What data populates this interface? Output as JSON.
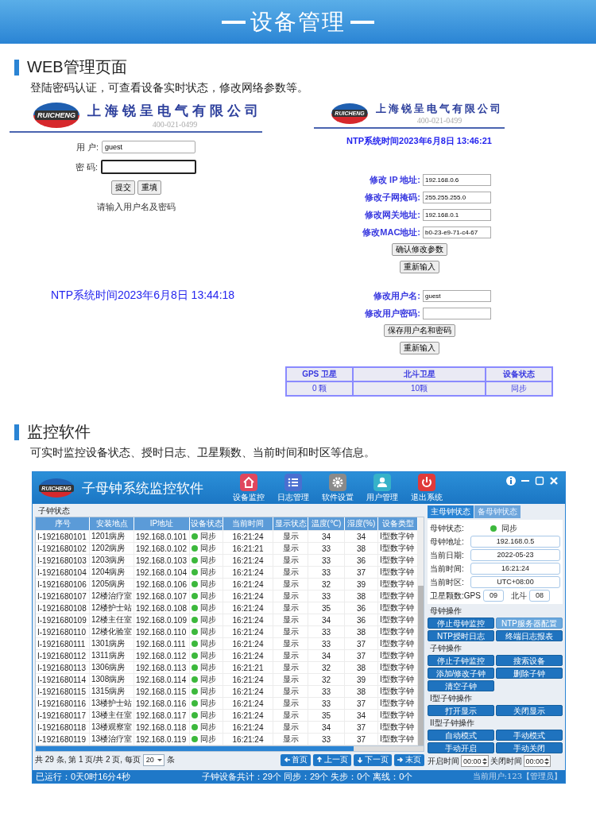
{
  "banner": {
    "title": "设备管理"
  },
  "sections": [
    {
      "heading": "WEB管理页面",
      "description": "登陆密码认证，可查看设备实时状态，修改网络参数等。"
    },
    {
      "heading": "监控软件",
      "description": "可实时监控设备状态、授时日志、卫星颗数、当前时间和时区等信息。"
    }
  ],
  "web_login": {
    "logo": "RUICHENG",
    "company": "上海锐呈电气有限公司",
    "phone": "400-021-0499",
    "fields": [
      {
        "label": "用 户:",
        "value": "guest",
        "focused": false
      },
      {
        "label": "密 码:",
        "focused": true
      }
    ],
    "buttons": [
      "提交",
      "重填"
    ],
    "prompt": "请输入用户名及密码",
    "ntp_time": "NTP系统时间2023年6月8日 13:44:18"
  },
  "web_config": {
    "logo": "RUICHENG",
    "company": "上海锐呈电气有限公司",
    "phone": "400-021-0499",
    "ntp_time": "NTP系统时间2023年6月8日 13:46:21",
    "network_fields": [
      {
        "label": "修改 IP 地址:",
        "value": "192.168.0.6"
      },
      {
        "label": "修改子网掩码:",
        "value": "255.255.255.0"
      },
      {
        "label": "修改网关地址:",
        "value": "192.168.0.1"
      },
      {
        "label": "修改MAC地址:",
        "value": "b0-23-e9-71-c4-67"
      }
    ],
    "network_buttons": [
      "确认修改参数",
      "重新输入"
    ],
    "user_fields": [
      {
        "label": "修改用户名:",
        "value": "guest"
      },
      {
        "label": "修改用户密码:"
      }
    ],
    "user_buttons": [
      "保存用户名和密码",
      "重新输入"
    ],
    "status_table": {
      "columns": [
        "GPS 卫星",
        "北斗卫星",
        "设备状态"
      ],
      "rows": [
        [
          "0 颗",
          "10颗",
          "同步"
        ]
      ]
    }
  },
  "software": {
    "logo": "RUICHENG",
    "title": "子母钟系统监控软件",
    "toolbar": [
      {
        "label": "设备监控",
        "kind": "home",
        "color": "#e0475e"
      },
      {
        "label": "日志管理",
        "kind": "list",
        "color": "#4a6fd0"
      },
      {
        "label": "软件设置",
        "kind": "gear",
        "color": "#8a8a8a"
      },
      {
        "label": "用户管理",
        "kind": "user",
        "color": "#36b2c9"
      },
      {
        "label": "退出系统",
        "kind": "power",
        "color": "#e03a3a"
      }
    ],
    "group_title": "子钟状态",
    "table": {
      "columns": [
        "序号",
        "安装地点",
        "IP地址",
        "设备状态",
        "当前时间",
        "显示状态",
        "温度(℃)",
        "湿度(%)",
        "设备类型"
      ],
      "rows": [
        [
          "I-1921680101",
          "1201病房",
          "192.168.0.101",
          "同步",
          "16:21:24",
          "显示",
          "34",
          "34",
          "I型数字钟"
        ],
        [
          "I-1921680102",
          "1202病房",
          "192.168.0.102",
          "同步",
          "16:21:21",
          "显示",
          "33",
          "38",
          "I型数字钟"
        ],
        [
          "I-1921680103",
          "1203病房",
          "192.168.0.103",
          "同步",
          "16:21:24",
          "显示",
          "33",
          "36",
          "I型数字钟"
        ],
        [
          "I-1921680104",
          "1204病房",
          "192.168.0.104",
          "同步",
          "16:21:24",
          "显示",
          "33",
          "37",
          "I型数字钟"
        ],
        [
          "I-1921680106",
          "1205病房",
          "192.168.0.106",
          "同步",
          "16:21:24",
          "显示",
          "32",
          "39",
          "I型数字钟"
        ],
        [
          "I-1921680107",
          "12楼治疗室",
          "192.168.0.107",
          "同步",
          "16:21:24",
          "显示",
          "33",
          "38",
          "I型数字钟"
        ],
        [
          "I-1921680108",
          "12楼护士站",
          "192.168.0.108",
          "同步",
          "16:21:24",
          "显示",
          "35",
          "36",
          "I型数字钟"
        ],
        [
          "I-1921680109",
          "12楼主任室",
          "192.168.0.109",
          "同步",
          "16:21:24",
          "显示",
          "34",
          "36",
          "I型数字钟"
        ],
        [
          "I-1921680110",
          "12楼化验室",
          "192.168.0.110",
          "同步",
          "16:21:24",
          "显示",
          "33",
          "38",
          "I型数字钟"
        ],
        [
          "I-1921680111",
          "1301病房",
          "192.168.0.111",
          "同步",
          "16:21:24",
          "显示",
          "33",
          "37",
          "I型数字钟"
        ],
        [
          "I-1921680112",
          "1311病房",
          "192.168.0.112",
          "同步",
          "16:21:24",
          "显示",
          "34",
          "37",
          "I型数字钟"
        ],
        [
          "I-1921680113",
          "1306病房",
          "192.168.0.113",
          "同步",
          "16:21:21",
          "显示",
          "32",
          "38",
          "I型数字钟"
        ],
        [
          "I-1921680114",
          "1308病房",
          "192.168.0.114",
          "同步",
          "16:21:24",
          "显示",
          "32",
          "39",
          "I型数字钟"
        ],
        [
          "I-1921680115",
          "1315病房",
          "192.168.0.115",
          "同步",
          "16:21:24",
          "显示",
          "33",
          "38",
          "I型数字钟"
        ],
        [
          "I-1921680116",
          "13楼护士站",
          "192.168.0.116",
          "同步",
          "16:21:24",
          "显示",
          "33",
          "37",
          "I型数字钟"
        ],
        [
          "I-1921680117",
          "13楼主任室",
          "192.168.0.117",
          "同步",
          "16:21:24",
          "显示",
          "35",
          "34",
          "I型数字钟"
        ],
        [
          "I-1921680118",
          "13楼观察室",
          "192.168.0.118",
          "同步",
          "16:21:24",
          "显示",
          "34",
          "37",
          "I型数字钟"
        ],
        [
          "I-1921680119",
          "13楼治疗室",
          "192.168.0.119",
          "同步",
          "16:21:24",
          "显示",
          "33",
          "37",
          "I型数字钟"
        ]
      ]
    },
    "pagination": {
      "summary": "共 29 条, 第 1 页/共 2 页, 每页",
      "page_size": "20",
      "unit": "条",
      "buttons": [
        {
          "label": "首页",
          "kind": "first"
        },
        {
          "label": "上一页",
          "kind": "prev"
        },
        {
          "label": "下一页",
          "kind": "next"
        },
        {
          "label": "末页",
          "kind": "last"
        }
      ]
    },
    "panel": {
      "tabs": [
        {
          "label": "主母钟状态",
          "selected": true
        },
        {
          "label": "备母钟状态",
          "selected": false
        }
      ],
      "status": {
        "label": "母钟状态:",
        "value": "同步"
      },
      "fields": [
        {
          "label": "母钟地址:",
          "value": "192.168.0.5"
        },
        {
          "label": "当前日期:",
          "value": "2022-05-23"
        },
        {
          "label": "当前时间:",
          "value": "16:21:24"
        },
        {
          "label": "当前时区:",
          "value": "UTC+08:00"
        }
      ],
      "satellites": {
        "label": "卫星颗数:GPS",
        "gps": "09",
        "beidou_label": "北斗",
        "beidou": "08"
      },
      "groups": [
        {
          "title": "母钟操作",
          "buttons": [
            {
              "label": "停止母钟监控",
              "highlighted": false
            },
            {
              "label": "NTP服务器配置",
              "highlighted": true
            },
            {
              "label": "NTP授时日志",
              "highlighted": false
            },
            {
              "label": "终端日志报表",
              "highlighted": false
            }
          ]
        },
        {
          "title": "子钟操作",
          "buttons": [
            {
              "label": "停止子钟监控",
              "highlighted": false
            },
            {
              "label": "搜索设备",
              "highlighted": false
            },
            {
              "label": "添加/修改子钟",
              "highlighted": false
            },
            {
              "label": "删除子钟",
              "highlighted": false
            },
            {
              "label": "清空子钟",
              "highlighted": false
            }
          ]
        },
        {
          "title": "I型子钟操作",
          "buttons": [
            {
              "label": "打开显示",
              "highlighted": false
            },
            {
              "label": "关闭显示",
              "highlighted": false
            }
          ]
        },
        {
          "title": "II型子钟操作",
          "buttons": [
            {
              "label": "自动模式",
              "highlighted": false
            },
            {
              "label": "手动模式",
              "highlighted": false
            },
            {
              "label": "手动开启",
              "highlighted": false
            },
            {
              "label": "手动关闭",
              "highlighted": false
            }
          ]
        }
      ],
      "times": [
        {
          "label": "开启时间",
          "value": "00:00"
        },
        {
          "label": "关闭时间",
          "value": "00:00"
        }
      ]
    },
    "status_bar": {
      "uptime": "已运行：0天0时16分4秒",
      "counts": "子钟设备共计：29个 同步：29个 失步：0个 离线：0个",
      "user": "当前用户:123【管理员】"
    }
  }
}
